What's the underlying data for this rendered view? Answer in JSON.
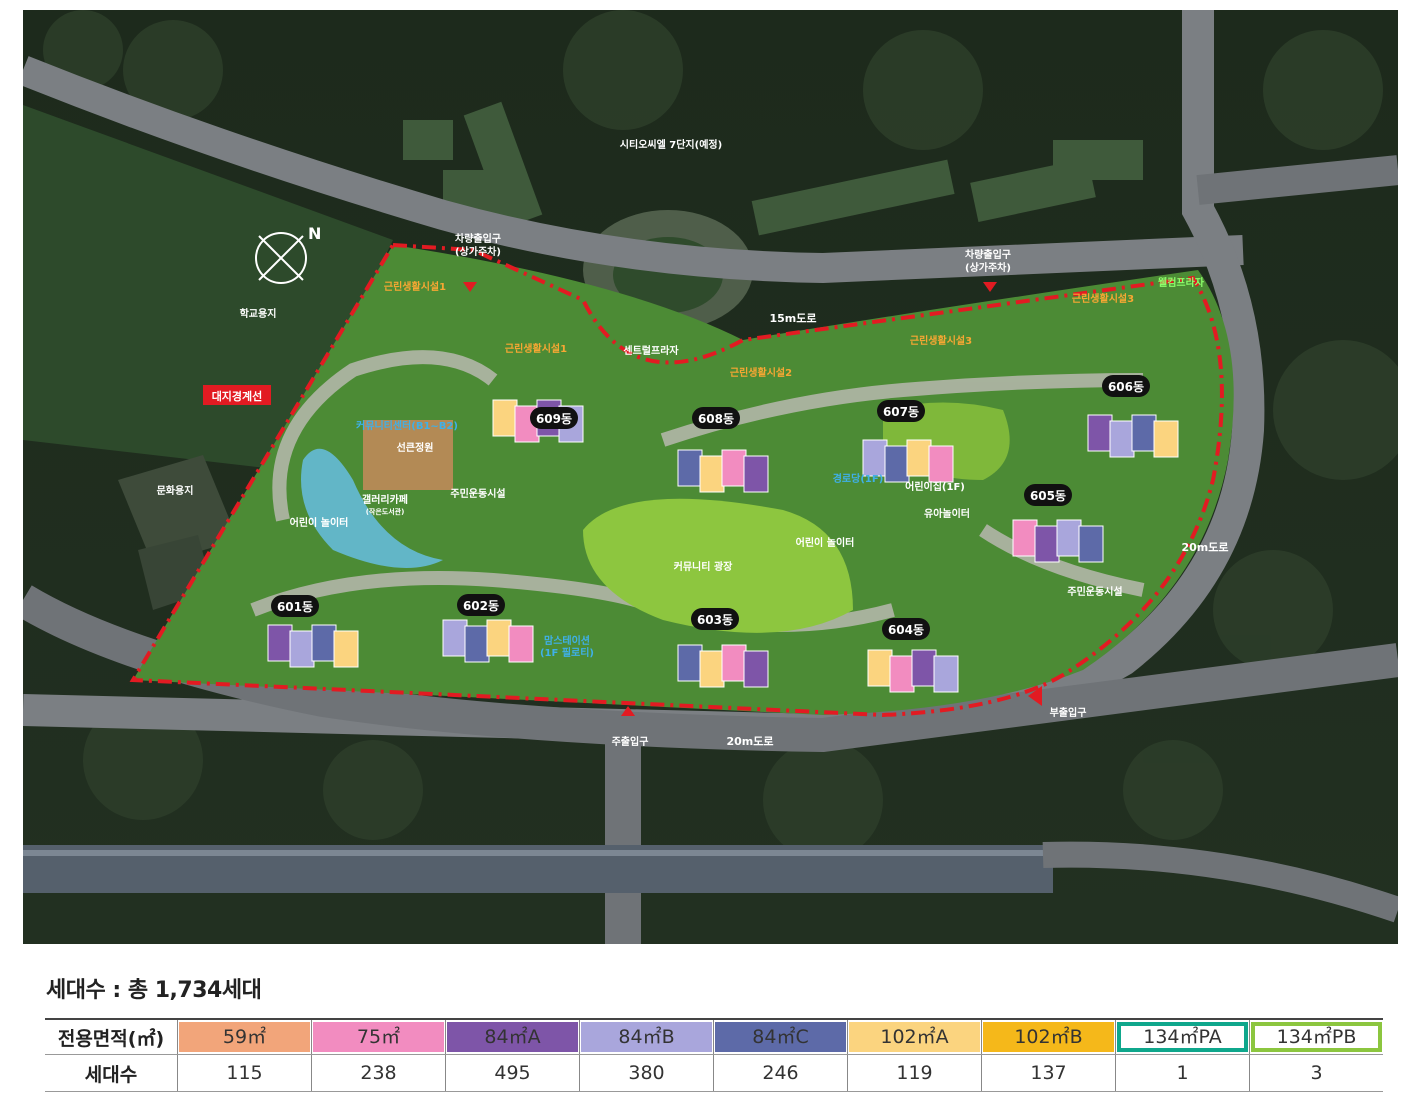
{
  "map": {
    "north_label": "N",
    "boundary_label": "대지경계선",
    "areas": {
      "school": "학교용지",
      "culture": "문화용지",
      "city7": "시티오씨엘 7단지(예정)",
      "central": "센트럴프라자",
      "welcome": "웰컴프라자",
      "plaza": "커뮤니티 광장"
    },
    "roads": {
      "r15": "15m도로",
      "r20a": "20m도로",
      "r20b": "20m도로"
    },
    "entrances": {
      "car1a": "차량출입구",
      "car1b": "(상가주차)",
      "car2a": "차량출입구",
      "car2b": "(상가주차)",
      "main": "주출입구",
      "sub": "부출입구"
    },
    "facilities": {
      "nf1a": "근린생활시설1",
      "nf1b": "근린생활시설1",
      "nf2": "근린생활시설2",
      "nf3a": "근린생활시설3",
      "nf3b": "근린생활시설3",
      "community": "커뮤니티센터(B1~B2)",
      "sunken": "선큰정원",
      "gallery": "갤러리카페",
      "gallery_sub": "(작은도서관)",
      "fitness1": "주민운동시설",
      "fitness2": "주민운동시설",
      "play1": "어린이 놀이터",
      "play2": "어린이 놀이터",
      "senior": "경로당(1F)",
      "daycare": "어린이집(1F)",
      "toddler": "유아놀이터",
      "moms": "맘스테이션",
      "moms_sub": "(1F 필로티)"
    },
    "buildings": {
      "b601": "601동",
      "b602": "602동",
      "b603": "603동",
      "b604": "604동",
      "b605": "605동",
      "b606": "606동",
      "b607": "607동",
      "b608": "608동",
      "b609": "609동"
    }
  },
  "units": {
    "title": "세대수 : 총 1,734세대",
    "area_header": "전용면적(㎡)",
    "count_header": "세대수",
    "types": [
      {
        "label": "59㎡",
        "count": "115",
        "color": "#f2a57a"
      },
      {
        "label": "75㎡",
        "count": "238",
        "color": "#f28cc0"
      },
      {
        "label": "84㎡A",
        "count": "495",
        "color": "#7e55a8"
      },
      {
        "label": "84㎡B",
        "count": "380",
        "color": "#a9a6dc"
      },
      {
        "label": "84㎡C",
        "count": "246",
        "color": "#5d6aa8"
      },
      {
        "label": "102㎡A",
        "count": "119",
        "color": "#fbd47f"
      },
      {
        "label": "102㎡B",
        "count": "137",
        "color": "#f5b81a"
      },
      {
        "label": "134㎡PA",
        "count": "1",
        "color": "#0fa78c"
      },
      {
        "label": "134㎡PB",
        "count": "3",
        "color": "#8cc63f"
      }
    ]
  }
}
